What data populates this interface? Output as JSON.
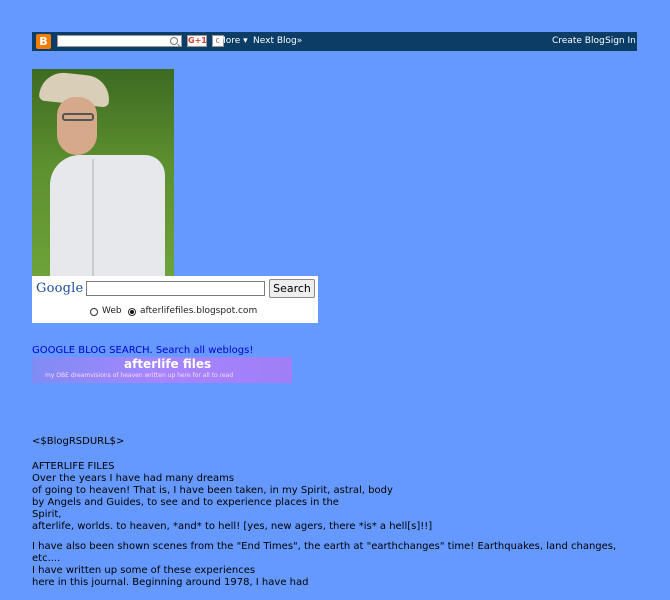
{
  "navbar": {
    "logo_letter": "B",
    "gplus_label": "G+1",
    "gplus_count": "0",
    "more_label": "More ▾",
    "next_blog_label": "Next Blog»",
    "create_blog_label": "Create Blog",
    "sign_in_label": "Sign In"
  },
  "search_widget": {
    "google_logo": "Google",
    "button_label": "Search",
    "option_web": "Web",
    "option_site": "afterlifefiles.blogspot.com"
  },
  "sidebar": {
    "google_blog_search_link": "GOOGLE BLOG SEARCH. Search all weblogs!"
  },
  "banner": {
    "title": "afterlife files",
    "subtitle": "my OBE dreamvisions of heaven written up here for all to read"
  },
  "meta": {
    "rsd_tag": "<$BlogRSDURL$>"
  },
  "post": {
    "title": "AFTERLIFE FILES",
    "lines": [
      "Over the years I have had many dreams",
      "of going to heaven! That is, I have been taken, in my Spirit, astral, body",
      "by Angels and Guides, to see and to experience places in the",
      "Spirit,",
      "afterlife, worlds. to heaven, *and* to hell! [yes, new agers, there *is* a hell[s]!!]",
      "",
      "I have also been shown scenes from the \"End Times\", the earth at \"earthchanges\" time! Earthquakes, land changes,",
      "etc....",
      "I have written up some of these experiences",
      "here in this journal. Beginning around 1978, I have had"
    ]
  },
  "colors": {
    "page_bg": "#6699ff",
    "navbar_bg": "#0b3d66",
    "link": "#0000cc"
  }
}
